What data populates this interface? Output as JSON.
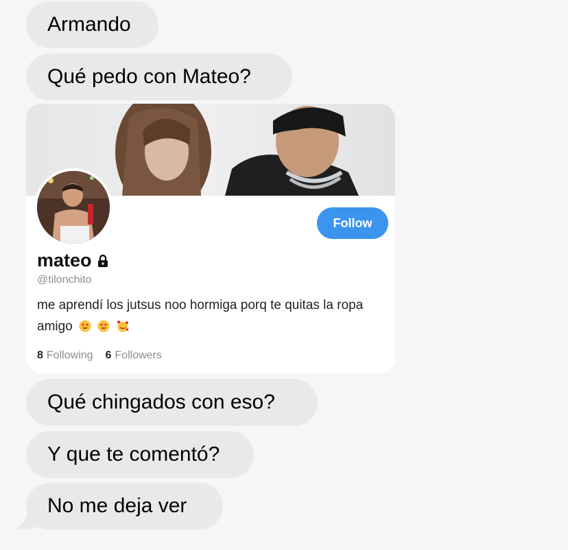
{
  "messages": [
    {
      "text": "Armando"
    },
    {
      "text": "Qué pedo con Mateo?"
    },
    {
      "text": "Qué chingados con eso?"
    },
    {
      "text": "Y que te comentó?"
    },
    {
      "text": "No me deja ver"
    }
  ],
  "profile_card": {
    "display_name": "mateo",
    "handle": "@tilonchito",
    "bio": "me aprendí los jutsus noo hormiga porq te quitas la ropa amigo",
    "bio_emojis": [
      "heart-eyes-emoji",
      "heart-eyes-emoji",
      "smiling-face-with-hearts-emoji"
    ],
    "follow_label": "Follow",
    "following_count": "8",
    "following_label": "Following",
    "followers_count": "6",
    "followers_label": "Followers",
    "icons": [
      "lock-icon"
    ]
  },
  "colors": {
    "received_bubble": "#e9e9eb",
    "background": "#f6f6f8",
    "follow_button": "#3b94ee"
  }
}
